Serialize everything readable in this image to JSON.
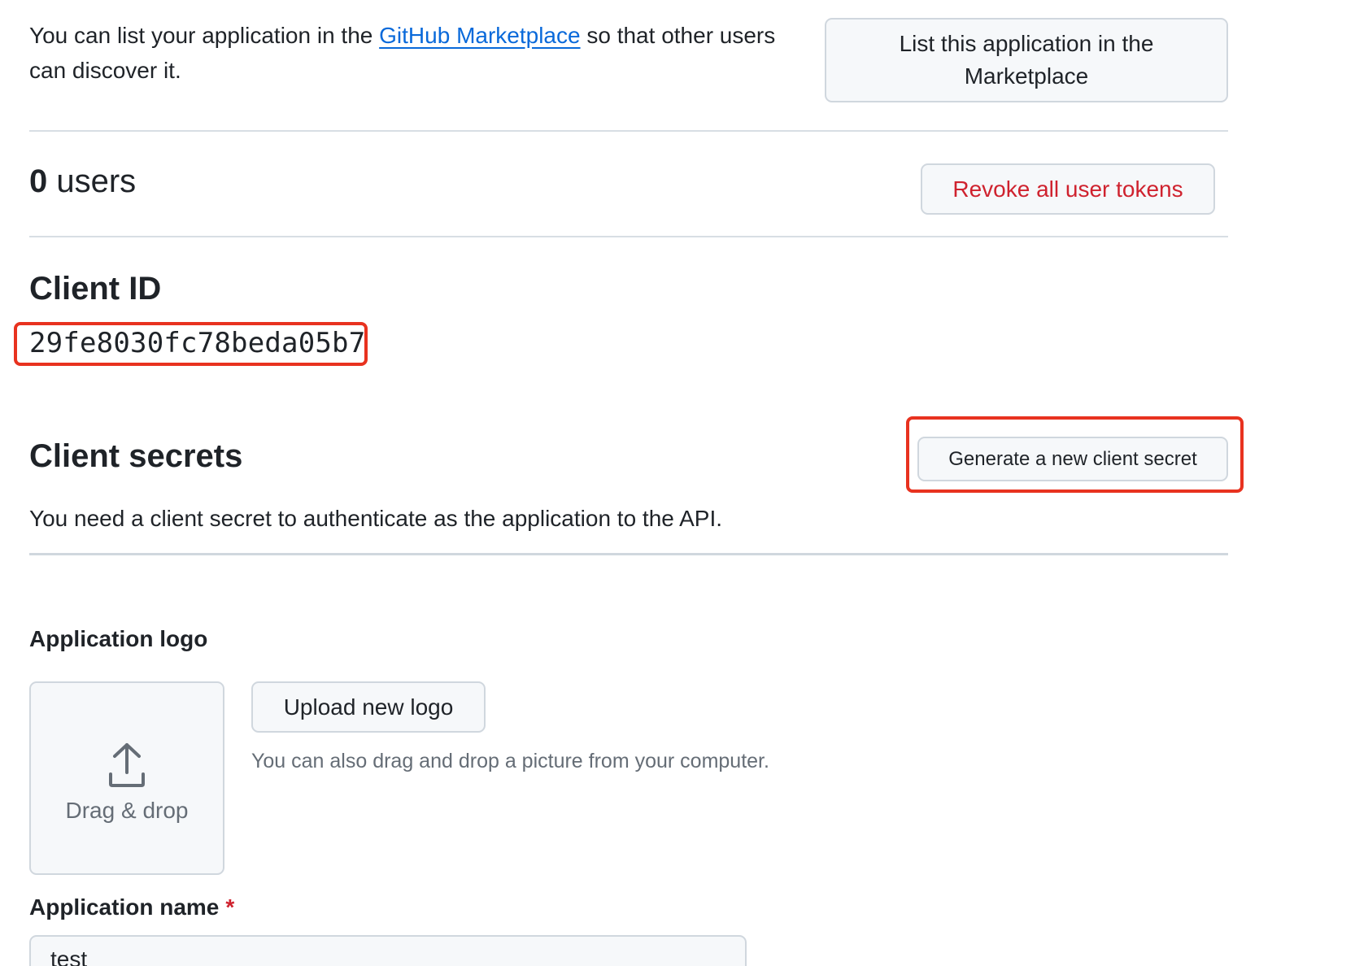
{
  "marketplace": {
    "text_before": "You can list your application in the ",
    "link": "GitHub Marketplace",
    "text_after": " so that other users can discover it.",
    "button": "List this application in the Marketplace"
  },
  "users": {
    "count": "0",
    "label": " users",
    "revoke_button": "Revoke all user tokens"
  },
  "client_id": {
    "title": "Client ID",
    "value": "29fe8030fc78beda05b7"
  },
  "client_secrets": {
    "title": "Client secrets",
    "generate_button": "Generate a new client secret",
    "description": "You need a client secret to authenticate as the application to the API."
  },
  "logo": {
    "label": "Application logo",
    "drop_icon": "upload-icon",
    "drop_text": "Drag & drop",
    "upload_button": "Upload new logo",
    "hint": "You can also drag and drop a picture from your computer."
  },
  "app_name": {
    "label": "Application name",
    "required_marker": "*",
    "value": "test"
  },
  "colors": {
    "link": "#0969da",
    "danger": "#cf222e",
    "highlight": "#e8321f"
  }
}
